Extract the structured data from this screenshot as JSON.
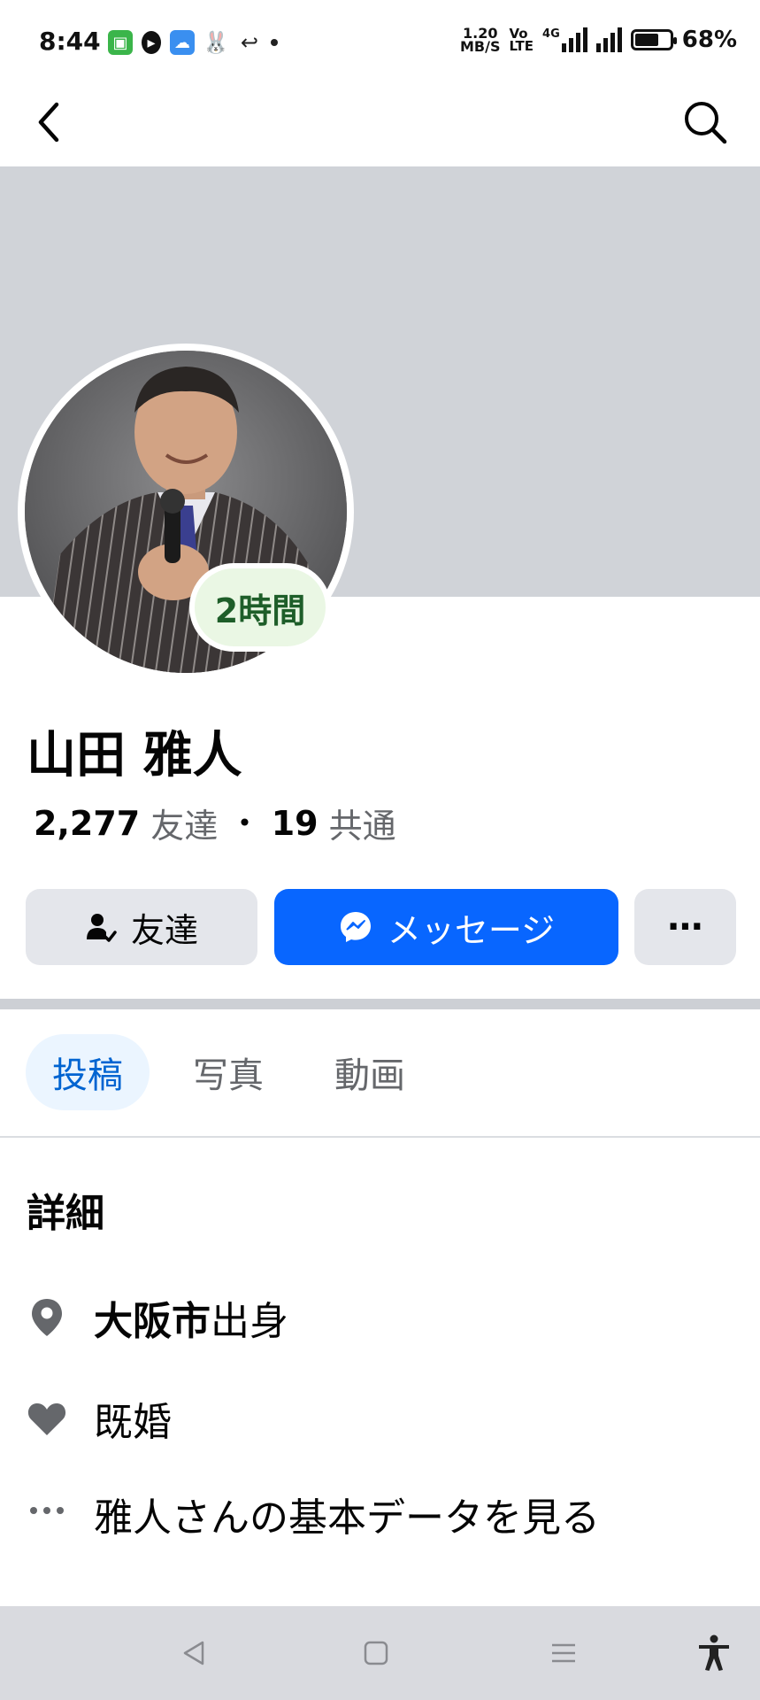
{
  "status_bar": {
    "time": "8:44",
    "net_speed_value": "1.20",
    "net_speed_unit": "MB/S",
    "volte_line1": "Vo",
    "volte_line2": "LTE",
    "network": "4G",
    "battery_percent": "68%",
    "battery_level": 0.68
  },
  "profile": {
    "name": "山田 雅人",
    "status_badge": "2時間",
    "friends_count": "2,277",
    "friends_label": "友達",
    "separator": "•",
    "mutual_count": "19",
    "mutual_label": "共通"
  },
  "actions": {
    "friends_label": "友達",
    "message_label": "メッセージ",
    "more_label": "⋯"
  },
  "tabs": [
    {
      "label": "投稿",
      "active": true
    },
    {
      "label": "写真",
      "active": false
    },
    {
      "label": "動画",
      "active": false
    }
  ],
  "details": {
    "title": "詳細",
    "hometown_bold": "大阪市",
    "hometown_suffix": "出身",
    "relationship": "既婚",
    "about_link": "雅人さんの基本データを見る"
  },
  "colors": {
    "accent": "#0866ff",
    "cover": "#d0d3d8",
    "status_badge_bg": "#eaf7e4"
  }
}
